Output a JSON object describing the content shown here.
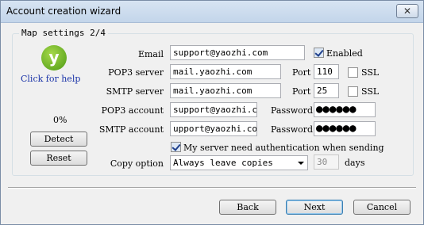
{
  "window": {
    "title": "Account creation wizard",
    "close_symbol": "✕"
  },
  "group": {
    "label": "Map settings 2/4"
  },
  "help": {
    "link_text": "Click for help",
    "logo_glyph": "y"
  },
  "progress": {
    "text": "0%"
  },
  "left_buttons": {
    "detect": "Detect",
    "reset": "Reset"
  },
  "email": {
    "label": "Email",
    "value": "support@yaozhi.com",
    "enabled_label": "Enabled",
    "enabled": true
  },
  "pop3": {
    "server_label": "POP3 server",
    "server_value": "mail.yaozhi.com",
    "port_label": "Port",
    "port_value": "110",
    "ssl_label": "SSL",
    "ssl": false
  },
  "smtp": {
    "server_label": "SMTP server",
    "server_value": "mail.yaozhi.com",
    "port_label": "Port",
    "port_value": "25",
    "ssl_label": "SSL",
    "ssl": false
  },
  "pop3_account": {
    "label": "POP3 account",
    "value": "support@yaozhi.co",
    "password_label": "Password",
    "password_mask": "●●●●●●"
  },
  "smtp_account": {
    "label": "SMTP account",
    "value": "upport@yaozhi.com",
    "password_label": "Password",
    "password_mask": "●●●●●●"
  },
  "auth": {
    "label": "My server need authentication when sending",
    "checked": true
  },
  "copy_option": {
    "label": "Copy option",
    "selected": "Always leave copies",
    "days_value": "30",
    "days_label": "days"
  },
  "footer": {
    "back": "Back",
    "next": "Next",
    "cancel": "Cancel"
  }
}
